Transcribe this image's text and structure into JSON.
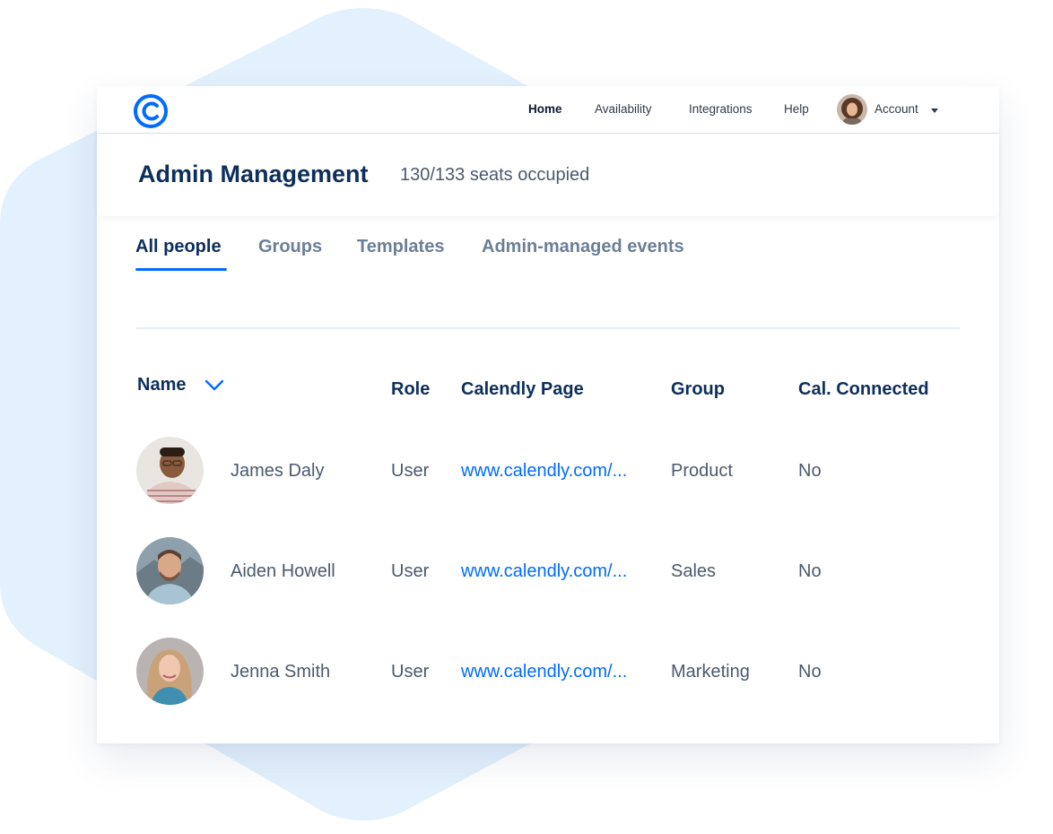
{
  "nav": {
    "items": [
      {
        "label": "Home",
        "active": true
      },
      {
        "label": "Availability",
        "active": false
      },
      {
        "label": "Integrations",
        "active": false
      },
      {
        "label": "Help",
        "active": false
      },
      {
        "label": "Account",
        "active": false
      }
    ]
  },
  "header": {
    "title": "Admin Management",
    "seats": "130/133 seats occupied"
  },
  "tabs": [
    {
      "label": "All people",
      "active": true
    },
    {
      "label": "Groups",
      "active": false
    },
    {
      "label": "Templates",
      "active": false
    },
    {
      "label": "Admin-managed events",
      "active": false
    }
  ],
  "table": {
    "columns": [
      "Name",
      "Role",
      "Calendly Page",
      "Group",
      "Cal. Connected"
    ],
    "sort_icon": "chevron-down-icon",
    "rows": [
      {
        "name": "James Daly",
        "role": "User",
        "page": "www.calendly.com/...",
        "group": "Product",
        "connected": "No"
      },
      {
        "name": "Aiden Howell",
        "role": "User",
        "page": "www.calendly.com/...",
        "group": "Sales",
        "connected": "No"
      },
      {
        "name": "Jenna Smith",
        "role": "User",
        "page": "www.calendly.com/...",
        "group": "Marketing",
        "connected": "No"
      }
    ]
  },
  "colors": {
    "accent": "#006bff",
    "heading": "#0d2f5a",
    "background_shape": "#e3f0fd"
  }
}
